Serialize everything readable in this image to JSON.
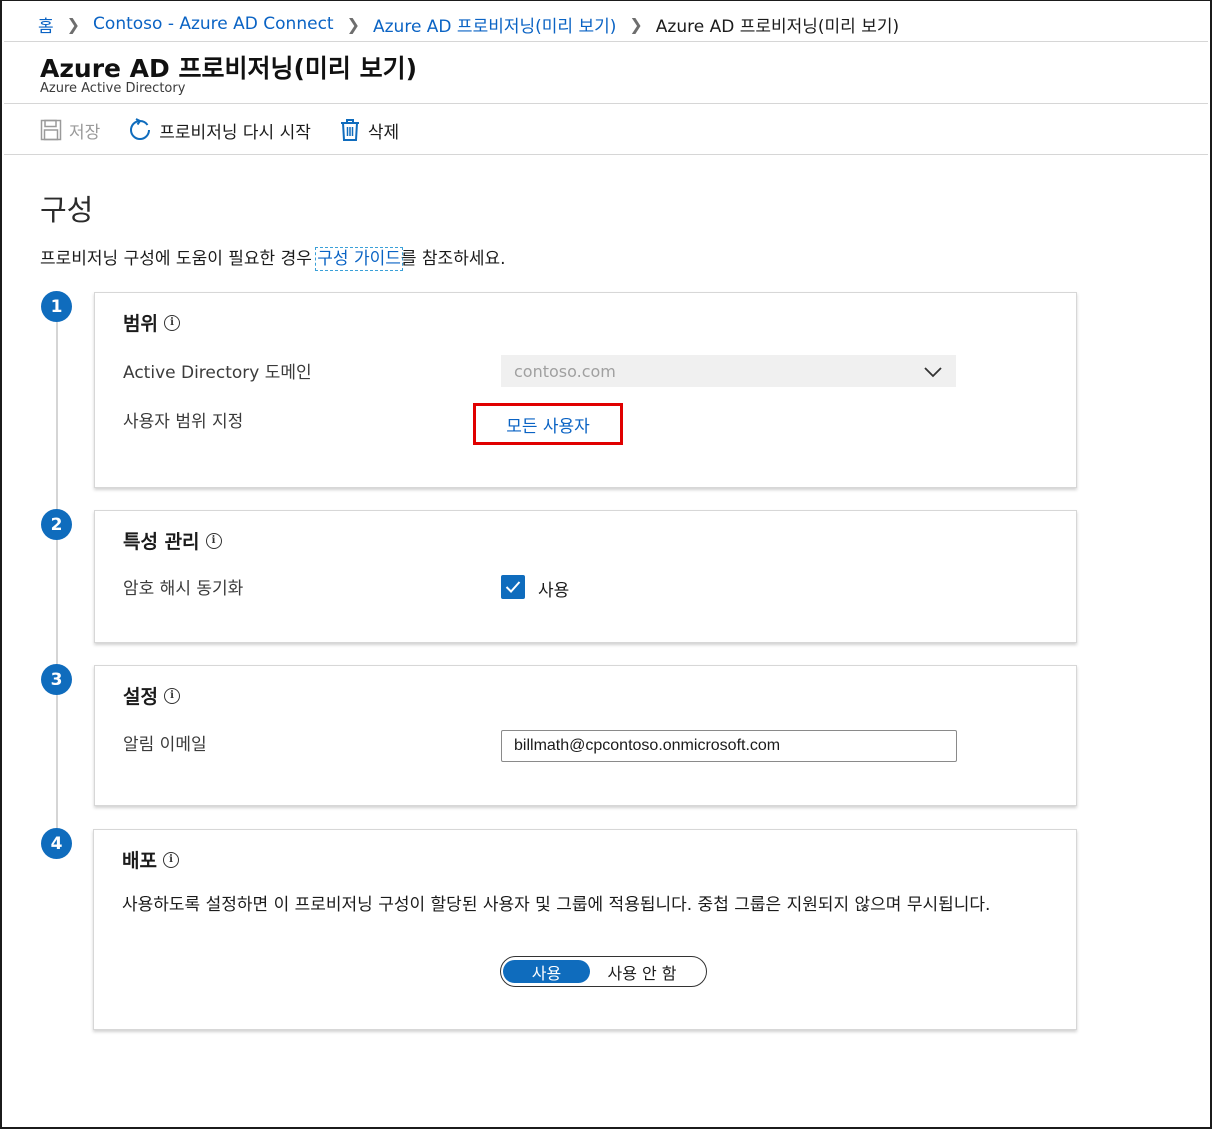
{
  "breadcrumb": {
    "home": "홈",
    "item1": "Contoso - Azure AD Connect",
    "item2": "Azure AD 프로비저닝(미리 보기)",
    "current": "Azure AD 프로비저닝(미리 보기)"
  },
  "header": {
    "title": "Azure AD 프로비저닝(미리 보기)",
    "subtitle": "Azure Active Directory"
  },
  "toolbar": {
    "save_label": "저장",
    "restart_label": "프로비저닝 다시 시작",
    "delete_label": "삭제"
  },
  "main": {
    "section_title": "구성",
    "help_prefix": "프로비저닝 구성에 도움이 필요한 경우 ",
    "help_link": "구성 가이드",
    "help_suffix": "를 참조하세요."
  },
  "steps": {
    "s1": "1",
    "s2": "2",
    "s3": "3",
    "s4": "4"
  },
  "scope": {
    "title": "범위",
    "domain_label": "Active Directory 도메인",
    "domain_value": "contoso.com",
    "user_scope_label": "사용자 범위 지정",
    "user_scope_value": "모든 사용자"
  },
  "attributes": {
    "title": "특성 관리",
    "phs_label": "암호 해시 동기화",
    "phs_checkbox_label": "사용",
    "phs_checked": true
  },
  "settings": {
    "title": "설정",
    "email_label": "알림 이메일",
    "email_value": "billmath@cpcontoso.onmicrosoft.com"
  },
  "deploy": {
    "title": "배포",
    "description": "사용하도록 설정하면 이 프로비저닝 구성이 할당된 사용자 및 그룹에 적용됩니다. 중첩 그룹은 지원되지 않으며 무시됩니다.",
    "toggle_on": "사용",
    "toggle_off": "사용 안 함",
    "selected": "사용"
  },
  "colors": {
    "accent": "#0f6cbd",
    "link": "#0a63c4",
    "highlight": "#e00000"
  }
}
